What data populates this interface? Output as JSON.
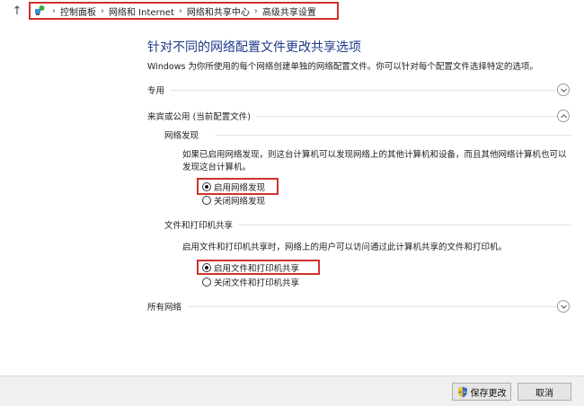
{
  "breadcrumb": {
    "items": [
      "控制面板",
      "网络和 Internet",
      "网络和共享中心",
      "高级共享设置"
    ]
  },
  "icons": {
    "up": "up-arrow-icon",
    "location": "network-location-icon",
    "chevron_down": "chevron-down-icon",
    "chevron_up": "chevron-up-icon",
    "shield": "uac-shield-icon"
  },
  "colors": {
    "title": "#1e3a8a",
    "highlight_box": "#d0312d"
  },
  "page": {
    "title": "针对不同的网络配置文件更改共享选项",
    "subtitle": "Windows 为你所使用的每个网络创建单独的网络配置文件。你可以针对每个配置文件选择特定的选项。"
  },
  "profiles": {
    "private": {
      "label": "专用",
      "expanded": false
    },
    "guest_public": {
      "label": "来宾或公用 (当前配置文件)",
      "expanded": true
    },
    "all": {
      "label": "所有网络",
      "expanded": false
    }
  },
  "network_discovery": {
    "heading": "网络发现",
    "description": "如果已启用网络发现，则这台计算机可以发现网络上的其他计算机和设备，而且其他网络计算机也可以发现这台计算机。",
    "options": [
      {
        "label": "启用网络发现",
        "checked": true
      },
      {
        "label": "关闭网络发现",
        "checked": false
      }
    ]
  },
  "file_printer_sharing": {
    "heading": "文件和打印机共享",
    "description": "启用文件和打印机共享时，网络上的用户可以访问通过此计算机共享的文件和打印机。",
    "options": [
      {
        "label": "启用文件和打印机共享",
        "checked": true
      },
      {
        "label": "关闭文件和打印机共享",
        "checked": false
      }
    ]
  },
  "footer": {
    "save_label": "保存更改",
    "cancel_label": "取消"
  }
}
